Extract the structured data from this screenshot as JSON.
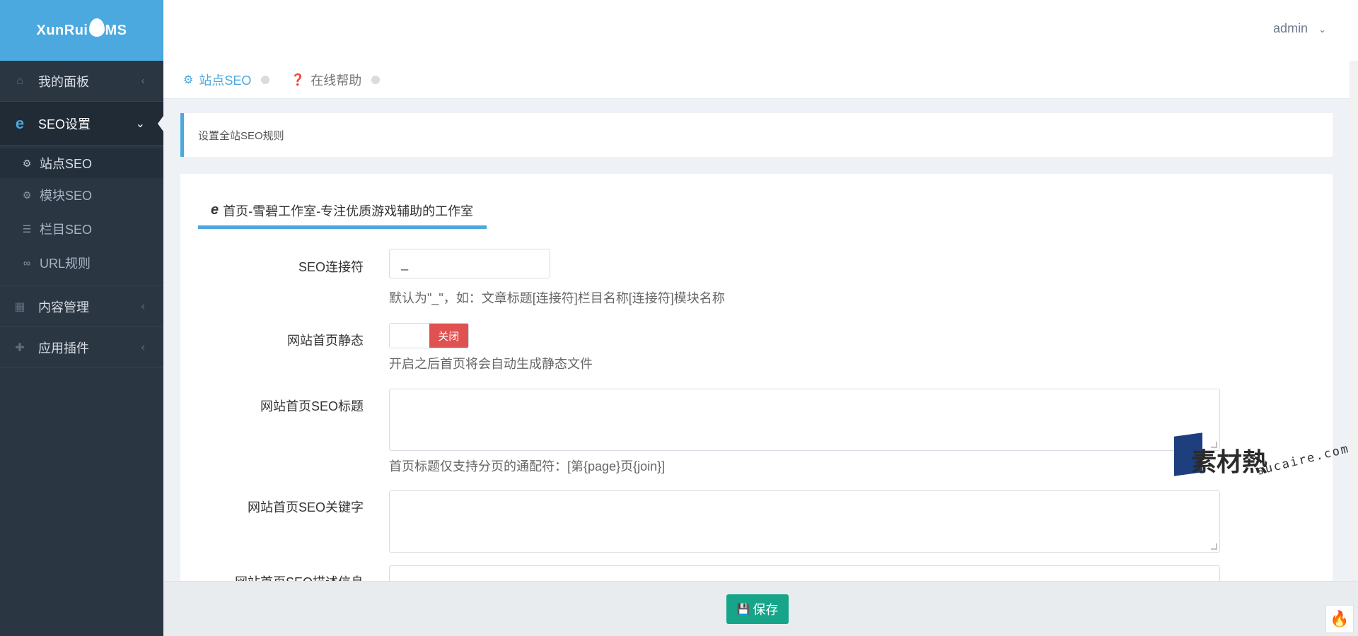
{
  "app": {
    "logo_text_a": "XunRui",
    "logo_text_b": "MS"
  },
  "header": {
    "user": "admin"
  },
  "sidebar": {
    "items": [
      {
        "label": "我的面板"
      },
      {
        "label": "SEO设置"
      },
      {
        "label": "内容管理"
      },
      {
        "label": "应用插件"
      }
    ],
    "sub_items": [
      {
        "label": "站点SEO"
      },
      {
        "label": "模块SEO"
      },
      {
        "label": "栏目SEO"
      },
      {
        "label": "URL规则"
      }
    ]
  },
  "page_tabs": [
    {
      "label": "站点SEO"
    },
    {
      "label": "在线帮助"
    }
  ],
  "note": {
    "text": "设置全站SEO规则"
  },
  "panel": {
    "tab_label": "首页-雪碧工作室-专注优质游戏辅助的工作室",
    "fields": {
      "connector": {
        "label": "SEO连接符",
        "value": "_",
        "help": "默认为\"_\"，如：文章标题[连接符]栏目名称[连接符]模块名称"
      },
      "static": {
        "label": "网站首页静态",
        "state": "关闭",
        "help": "开启之后首页将会自动生成静态文件"
      },
      "title": {
        "label": "网站首页SEO标题",
        "value": "",
        "help": "首页标题仅支持分页的通配符：[第{page}页{join}]"
      },
      "keywords": {
        "label": "网站首页SEO关键字",
        "value": ""
      },
      "description": {
        "label": "网站首页SEO描述信息"
      }
    }
  },
  "footer": {
    "save_label": "保存"
  },
  "watermark": {
    "text": "素材熱",
    "url": "sucaire.com"
  },
  "colors": {
    "accent": "#4ba9df",
    "sidebar": "#2b3643",
    "save": "#16a589",
    "off": "#e05151"
  },
  "icons": {
    "dashboard": "home-icon",
    "seo": "ie-icon",
    "content": "grid-icon",
    "plugins": "puzzle-icon",
    "site_seo": "gear-icon",
    "module_seo": "gears-icon",
    "column_seo": "list-icon",
    "url_rules": "link-icon",
    "help": "question-circle-icon",
    "save": "floppy-icon"
  }
}
